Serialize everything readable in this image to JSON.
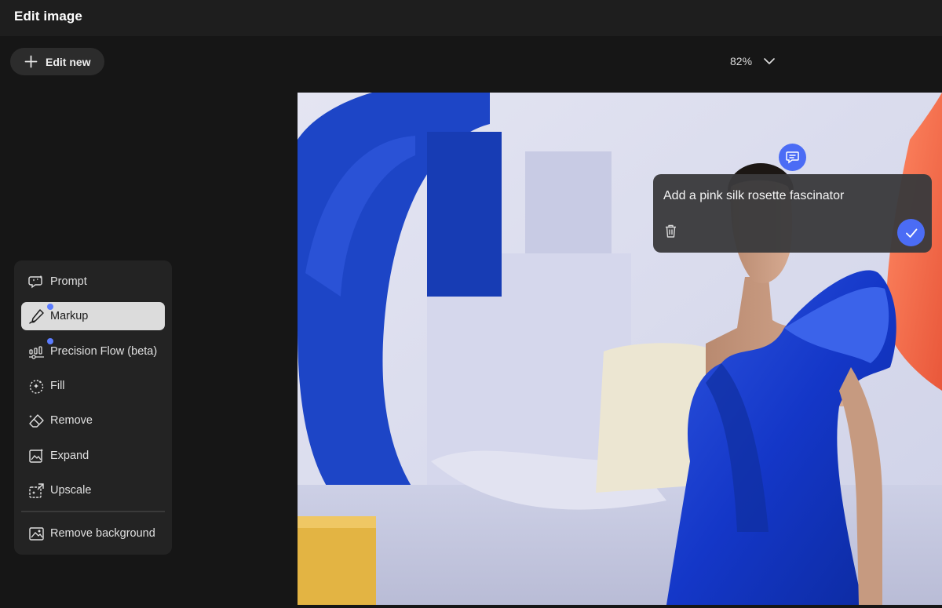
{
  "header": {
    "title": "Edit image"
  },
  "toolbar": {
    "edit_new_label": "Edit new"
  },
  "zoom": {
    "value": "82%"
  },
  "tools": [
    {
      "label": "Prompt",
      "icon": "prompt-icon",
      "active": false,
      "new_badge": false
    },
    {
      "label": "Markup",
      "icon": "markup-icon",
      "active": true,
      "new_badge": true
    },
    {
      "label": "Precision Flow (beta)",
      "icon": "precision-flow-icon",
      "active": false,
      "new_badge": true
    },
    {
      "label": "Fill",
      "icon": "fill-icon",
      "active": false,
      "new_badge": false
    },
    {
      "label": "Remove",
      "icon": "remove-icon",
      "active": false,
      "new_badge": false
    },
    {
      "label": "Expand",
      "icon": "expand-icon",
      "active": false,
      "new_badge": false
    },
    {
      "label": "Upscale",
      "icon": "upscale-icon",
      "active": false,
      "new_badge": false
    },
    {
      "label": "Remove background",
      "icon": "remove-background-icon",
      "active": false,
      "new_badge": false
    }
  ],
  "prompt_popup": {
    "text": "Add a pink silk rosette fascinator"
  },
  "colors": {
    "accent": "#4b6cf5",
    "badge": "#5b7cff",
    "background": "#161616",
    "panel": "#232323",
    "active_tool": "#dcdcdc"
  }
}
